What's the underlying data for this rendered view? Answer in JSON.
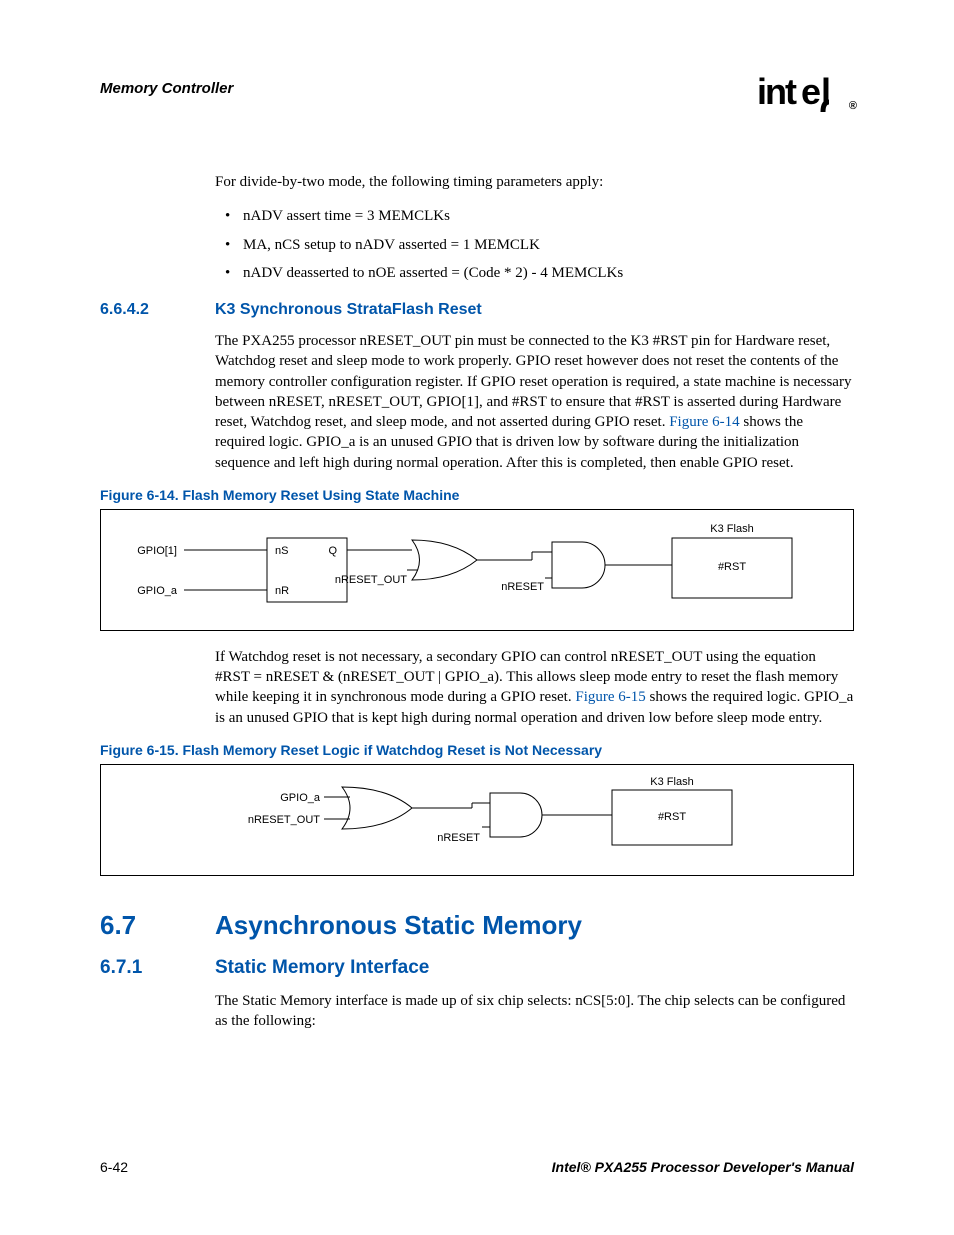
{
  "header": {
    "section_title": "Memory Controller",
    "logo_text": "intel",
    "logo_reg": "®"
  },
  "intro": {
    "lead_para": "For divide-by-two mode, the following timing parameters apply:",
    "bullets": [
      "nADV assert time = 3 MEMCLKs",
      "MA, nCS setup to nADV asserted = 1 MEMCLK",
      "nADV deasserted to nOE asserted = (Code * 2) - 4 MEMCLKs"
    ]
  },
  "sec_6642": {
    "num": "6.6.4.2",
    "title": "K3 Synchronous StrataFlash Reset",
    "para1_a": "The PXA255 processor nRESET_OUT pin must be connected to the K3 #RST pin for Hardware reset, Watchdog reset and sleep mode to work properly. GPIO reset however does not reset the contents of the memory controller configuration register. If GPIO reset operation is required, a state machine is necessary between nRESET, nRESET_OUT, GPIO[1], and #RST to ensure that #RST is asserted during Hardware reset, Watchdog reset, and sleep mode, and not asserted during GPIO reset. ",
    "para1_xref": "Figure 6-14",
    "para1_b": " shows the required logic. GPIO_a is an unused GPIO that is driven low by software during the initialization sequence and left high during normal operation. After this is completed, then enable GPIO reset.",
    "fig14_caption": "Figure 6-14. Flash Memory Reset Using State Machine",
    "fig14": {
      "gpio1": "GPIO[1]",
      "gpioa": "GPIO_a",
      "nS": "nS",
      "Q": "Q",
      "nR": "nR",
      "nreset_out": "nRESET_OUT",
      "nreset": "nRESET",
      "k3flash": "K3 Flash",
      "rst": "#RST"
    },
    "para2_a": "If Watchdog reset is not necessary, a secondary GPIO can control nRESET_OUT using the equation #RST = nRESET & (nRESET_OUT | GPIO_a). This allows sleep mode entry to reset the flash memory while keeping it in synchronous mode during a GPIO reset. ",
    "para2_xref": "Figure 6-15",
    "para2_b": " shows the required logic. GPIO_a is an unused GPIO that is kept high during normal operation and driven low before sleep mode entry.",
    "fig15_caption": "Figure 6-15. Flash Memory Reset Logic if Watchdog Reset is Not Necessary",
    "fig15": {
      "gpioa": "GPIO_a",
      "nreset_out": "nRESET_OUT",
      "nreset": "nRESET",
      "k3flash": "K3 Flash",
      "rst": "#RST"
    }
  },
  "sec_67": {
    "num": "6.7",
    "title": "Asynchronous Static Memory"
  },
  "sec_671": {
    "num": "6.7.1",
    "title": "Static Memory Interface",
    "para": "The Static Memory interface is made up of six chip selects: nCS[5:0]. The chip selects can be configured as the following:"
  },
  "footer": {
    "page": "6-42",
    "doc": "Intel® PXA255 Processor Developer's Manual"
  }
}
